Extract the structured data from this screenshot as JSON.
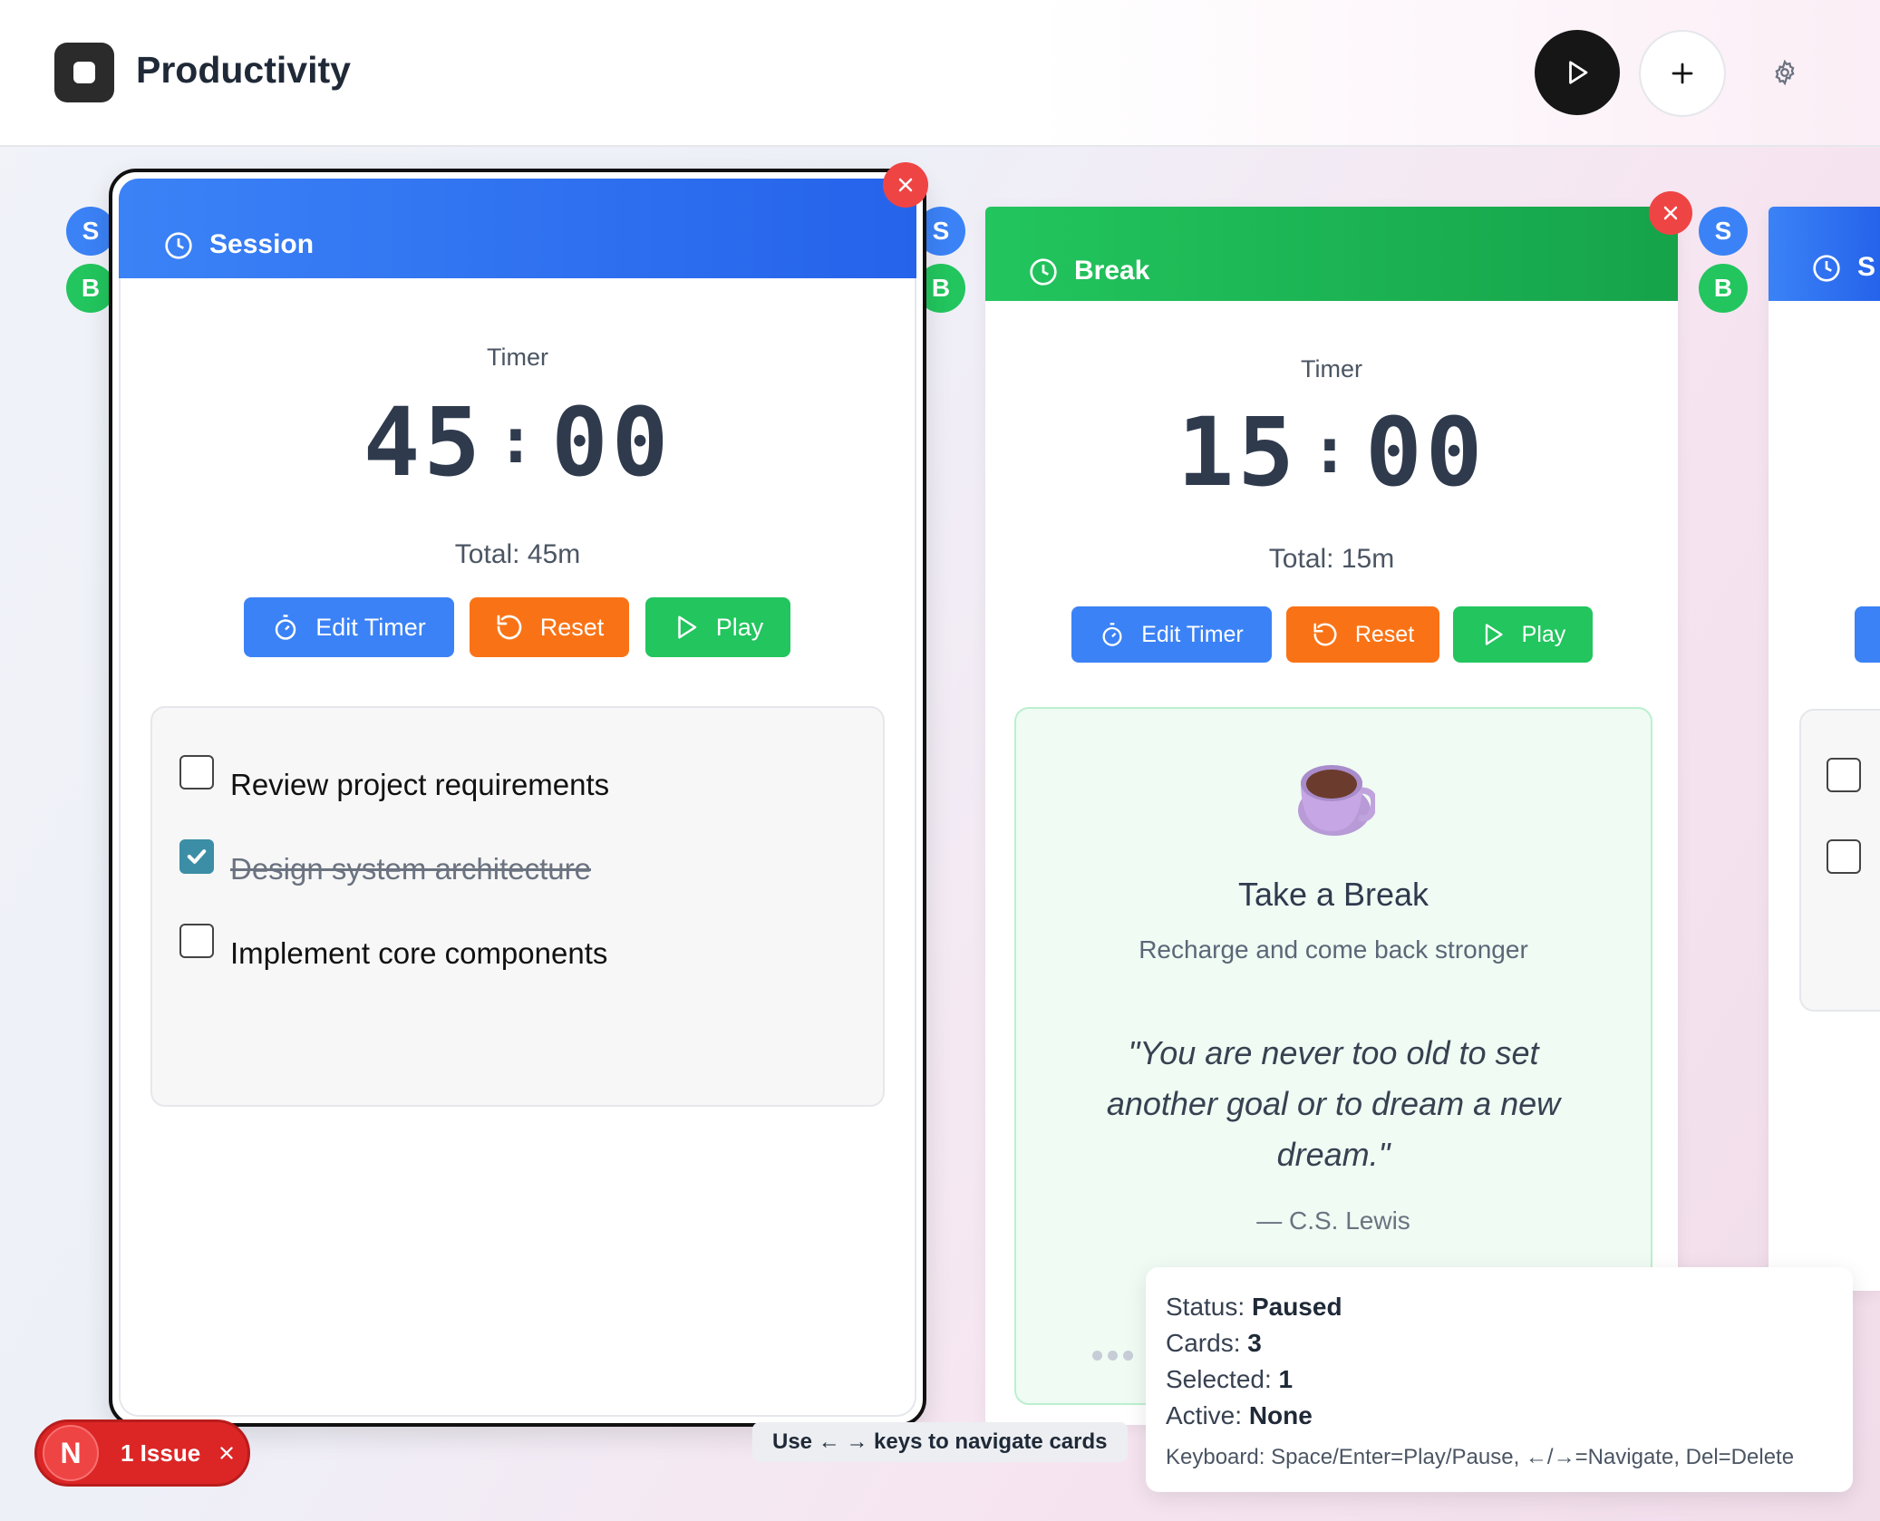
{
  "header": {
    "app_title": "Productivity",
    "play_icon": "play-icon",
    "add_icon": "plus-icon",
    "settings_icon": "gear-icon"
  },
  "avatars": {
    "s": "S",
    "b": "B"
  },
  "cards": [
    {
      "title": "Session",
      "color": "#3b82f6",
      "timer_label": "Timer",
      "minutes": "45",
      "separator": ":",
      "seconds": "00",
      "total": "Total: 45m",
      "buttons": {
        "edit": "Edit Timer",
        "reset": "Reset",
        "play": "Play"
      },
      "tasks": [
        {
          "text": "Review project requirements",
          "done": false
        },
        {
          "text": "Design system architecture",
          "done": true
        },
        {
          "text": "Implement core components",
          "done": false
        }
      ]
    },
    {
      "title": "Break",
      "color": "#22c55e",
      "timer_label": "Timer",
      "minutes": "15",
      "separator": ":",
      "seconds": "00",
      "total": "Total: 15m",
      "buttons": {
        "edit": "Edit Timer",
        "reset": "Reset",
        "play": "Play"
      },
      "break_panel": {
        "icon": "coffee-cup-icon",
        "title": "Take a Break",
        "subtitle": "Recharge and come back stronger",
        "quote_line1": "\"You are never too old to set",
        "quote_line2": "another goal or to dream a new",
        "quote_line3": "dream.\"",
        "author": "— C.S. Lewis"
      }
    },
    {
      "title": "S",
      "color": "#3b82f6"
    }
  ],
  "hint": "Use ← → keys to navigate cards",
  "status": {
    "status_label": "Status:",
    "status_value": "Paused",
    "cards_label": "Cards:",
    "cards_value": "3",
    "selected_label": "Selected:",
    "selected_value": "1",
    "active_label": "Active:",
    "active_value": "None",
    "keyboard": "Keyboard: Space/Enter=Play/Pause, ←/→=Navigate, Del=Delete"
  },
  "issue": {
    "badge": "N",
    "label": "1 Issue"
  }
}
